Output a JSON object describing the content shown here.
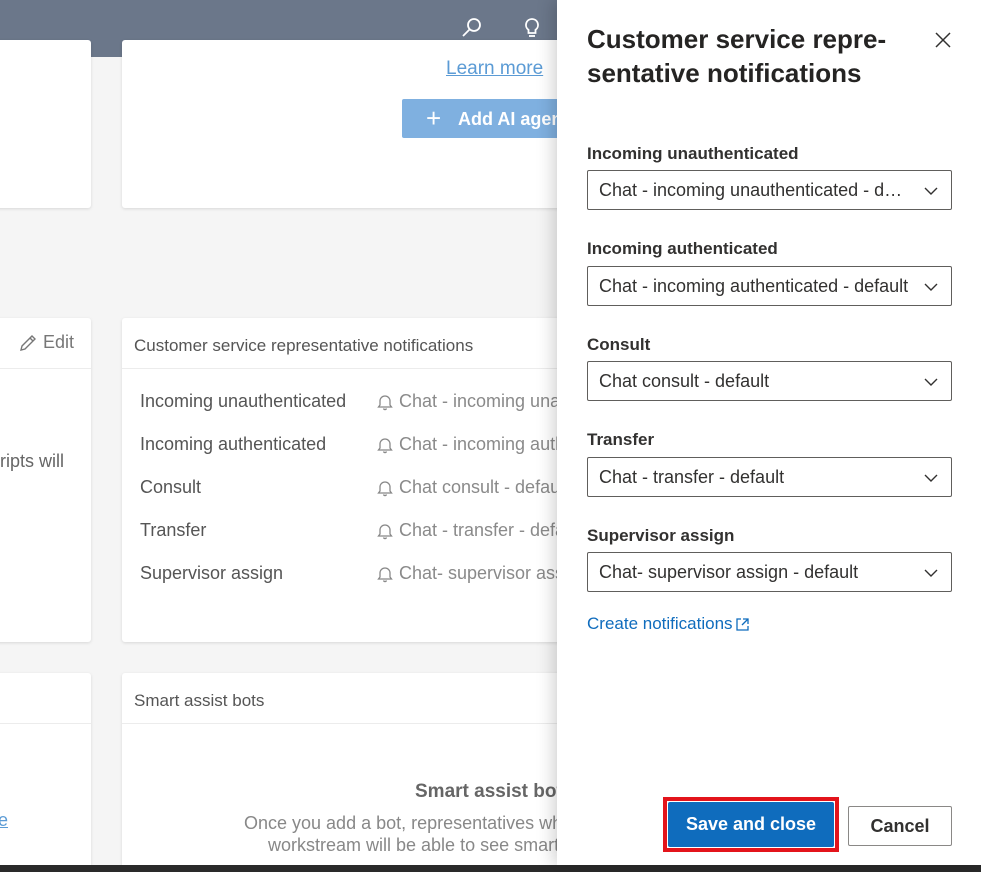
{
  "background": {
    "top_card": {
      "learn_more": "Learn more",
      "add_ai_agent": "Add AI agen"
    },
    "left_card": {
      "edit_label": "Edit",
      "text_fragment": "ripts will",
      "link_fragment": "e"
    },
    "notifications_card": {
      "title": "Customer service representative notifications",
      "rows": [
        {
          "label": "Incoming unauthenticated",
          "value": "Chat - incoming una"
        },
        {
          "label": "Incoming authenticated",
          "value": "Chat - incoming auth"
        },
        {
          "label": "Consult",
          "value": "Chat consult - defaul"
        },
        {
          "label": "Transfer",
          "value": "Chat - transfer - defa"
        },
        {
          "label": "Supervisor assign",
          "value": "Chat- supervisor assi"
        }
      ]
    },
    "smart_assist_card": {
      "title": "Smart assist bots",
      "empty_title": "Smart assist bot",
      "empty_line1": "Once you add a bot, representatives who",
      "empty_line2": "workstream will be able to see smart assi"
    }
  },
  "panel": {
    "title": "Customer service repre-sentative notifications",
    "title_line1": "Customer service repre-",
    "title_line2": "sentative notifications",
    "fields": [
      {
        "label": "Incoming unauthenticated",
        "value": "Chat - incoming unauthenticated - def..."
      },
      {
        "label": "Incoming authenticated",
        "value": "Chat - incoming authenticated - default"
      },
      {
        "label": "Consult",
        "value": "Chat consult - default"
      },
      {
        "label": "Transfer",
        "value": "Chat - transfer - default"
      },
      {
        "label": "Supervisor assign",
        "value": "Chat- supervisor assign - default"
      }
    ],
    "create_link": "Create notifications",
    "save_label": "Save and close",
    "cancel_label": "Cancel"
  },
  "colors": {
    "topbar": "#6b778a",
    "primary": "#0f6cbd",
    "highlight": "#e3141b",
    "link": "#0f6cbd"
  },
  "icons": [
    "search-icon",
    "lightbulb-icon",
    "plus-icon",
    "pencil-icon",
    "bell-icon",
    "close-icon",
    "chevron-down-icon",
    "external-link-icon"
  ]
}
